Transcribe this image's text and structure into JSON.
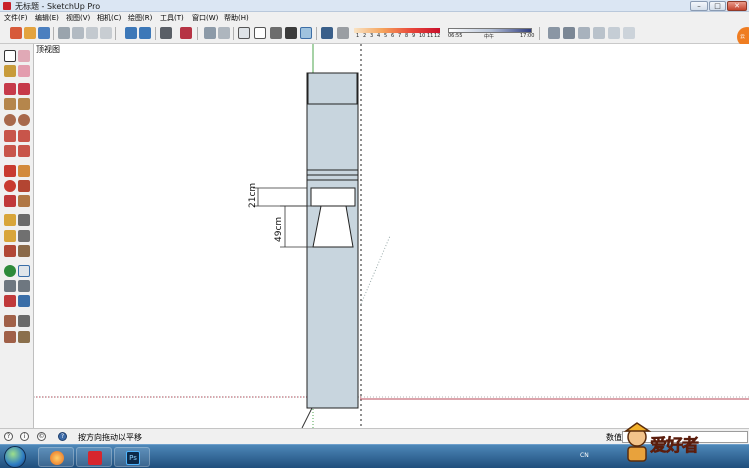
{
  "window": {
    "title": "无标题 - SketchUp Pro",
    "minimize_icon": "minimize-icon",
    "maximize_icon": "maximize-icon",
    "close_icon": "close-icon",
    "minimize_glyph": "–",
    "maximize_glyph": "□",
    "close_glyph": "✕"
  },
  "menu": {
    "items": [
      {
        "label": "文件(F)"
      },
      {
        "label": "编辑(E)"
      },
      {
        "label": "视图(V)"
      },
      {
        "label": "相机(C)"
      },
      {
        "label": "绘图(R)"
      },
      {
        "label": "工具(T)"
      },
      {
        "label": "窗口(W)"
      },
      {
        "label": "帮助(H)"
      }
    ]
  },
  "toolbar": {
    "shadow_numbers": [
      "1",
      "2",
      "3",
      "4",
      "5",
      "6",
      "7",
      "8",
      "9",
      "10",
      "11",
      "12"
    ],
    "time_start": "06:55",
    "time_mid": "中午",
    "time_end": "17:00",
    "accent_color": "#c8102b"
  },
  "canvas": {
    "view_label": "顶视图",
    "dimension_1": "21cm",
    "dimension_2": "49cm",
    "model_fill": "#c8d5de",
    "axis_green": "#4ca64c",
    "axis_red": "#b94a5a"
  },
  "status": {
    "text": "按方向拖动以平移",
    "measure_label": "数值",
    "measure_value": "",
    "icons": [
      "info-icon",
      "geolocation-icon",
      "credit-icon",
      "help-icon"
    ]
  },
  "taskbar": {
    "apps": [
      "start-orb",
      "browser-icon",
      "sketchup-icon",
      "photoshop-icon"
    ],
    "photoshop_label": "Ps",
    "language": "CN",
    "watermark_text": "爱好者"
  },
  "right_tab": {
    "label": "云"
  }
}
